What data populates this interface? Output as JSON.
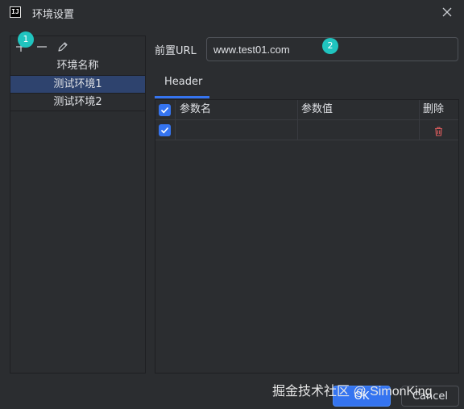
{
  "window": {
    "app_icon_text": "IJ",
    "title": "环境设置"
  },
  "env_list": {
    "header": "环境名称",
    "items": [
      {
        "label": "测试环境1",
        "selected": true
      },
      {
        "label": "测试环境2",
        "selected": false
      }
    ],
    "badge": "1"
  },
  "url": {
    "label": "前置URL",
    "value": "www.test01.com",
    "badge": "2"
  },
  "tabs": [
    {
      "label": "Header",
      "active": true
    }
  ],
  "table": {
    "columns": [
      "参数名",
      "参数值",
      "删除"
    ],
    "rows": [
      {
        "checked": true,
        "name": "",
        "value": ""
      }
    ],
    "header_checked": true
  },
  "buttons": {
    "ok": "OK",
    "cancel": "Cancel"
  },
  "watermark": "掘金技术社区 @ SimonKing",
  "colors": {
    "background": "#2b2d30",
    "selection": "#2e436e",
    "accent": "#3574f0",
    "badge": "#20c4bf",
    "delete": "#db5c5c"
  },
  "icons": [
    "close-icon",
    "add-icon",
    "remove-icon",
    "edit-icon",
    "check-icon",
    "trash-icon"
  ]
}
